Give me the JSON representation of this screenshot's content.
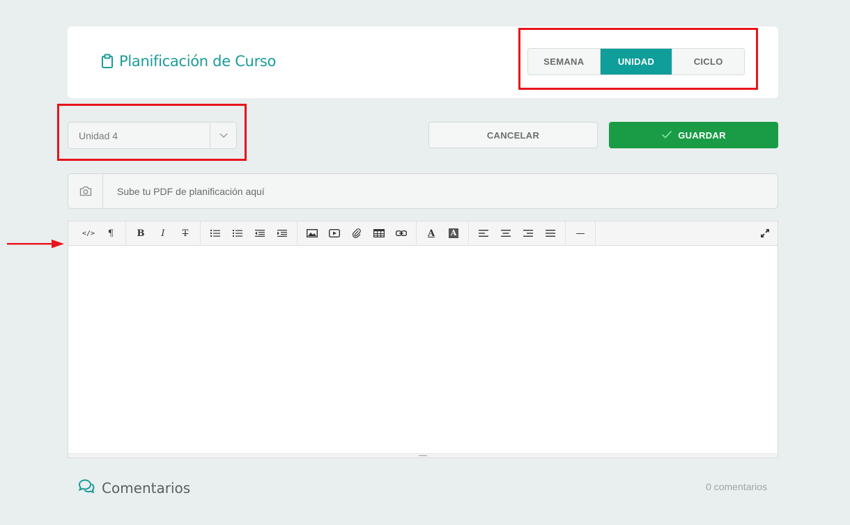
{
  "header": {
    "title": "Planificación de Curso",
    "title_icon": "clipboard-icon",
    "periods": [
      {
        "label": "SEMANA",
        "active": false
      },
      {
        "label": "UNIDAD",
        "active": true
      },
      {
        "label": "CICLO",
        "active": false
      }
    ]
  },
  "unit_select": {
    "value": "Unidad 4",
    "icon": "chevron-down-icon"
  },
  "actions": {
    "cancel_label": "CANCELAR",
    "save_label": "GUARDAR",
    "save_icon": "checkmark-icon"
  },
  "upload": {
    "placeholder": "Sube tu PDF de planificación aquí",
    "icon": "camera-icon"
  },
  "editor": {
    "toolbar": [
      {
        "name": "code-view-icon",
        "glyph": "</>"
      },
      {
        "name": "paragraph-icon",
        "glyph": "¶"
      },
      {
        "name": "bold-icon",
        "glyph": "B"
      },
      {
        "name": "italic-icon",
        "glyph": "I"
      },
      {
        "name": "strikethrough-icon",
        "glyph": "T"
      },
      {
        "name": "unordered-list-icon",
        "glyph": ""
      },
      {
        "name": "ordered-list-icon",
        "glyph": ""
      },
      {
        "name": "outdent-icon",
        "glyph": ""
      },
      {
        "name": "indent-icon",
        "glyph": ""
      },
      {
        "name": "image-icon",
        "glyph": ""
      },
      {
        "name": "video-icon",
        "glyph": ""
      },
      {
        "name": "attachment-icon",
        "glyph": ""
      },
      {
        "name": "table-icon",
        "glyph": ""
      },
      {
        "name": "link-icon",
        "glyph": ""
      },
      {
        "name": "font-color-icon",
        "glyph": "A"
      },
      {
        "name": "background-color-icon",
        "glyph": "A"
      },
      {
        "name": "align-left-icon",
        "glyph": ""
      },
      {
        "name": "align-center-icon",
        "glyph": ""
      },
      {
        "name": "align-right-icon",
        "glyph": ""
      },
      {
        "name": "align-justify-icon",
        "glyph": ""
      },
      {
        "name": "horizontal-rule-icon",
        "glyph": "—"
      },
      {
        "name": "fullscreen-icon",
        "glyph": ""
      }
    ]
  },
  "comments": {
    "title": "Comentarios",
    "count": "0 comentarios",
    "icon": "comments-icon"
  },
  "colors": {
    "accent": "#0f9e9a",
    "save": "#1a9c46",
    "highlight": "#e8141b",
    "background": "#e9eeee"
  }
}
